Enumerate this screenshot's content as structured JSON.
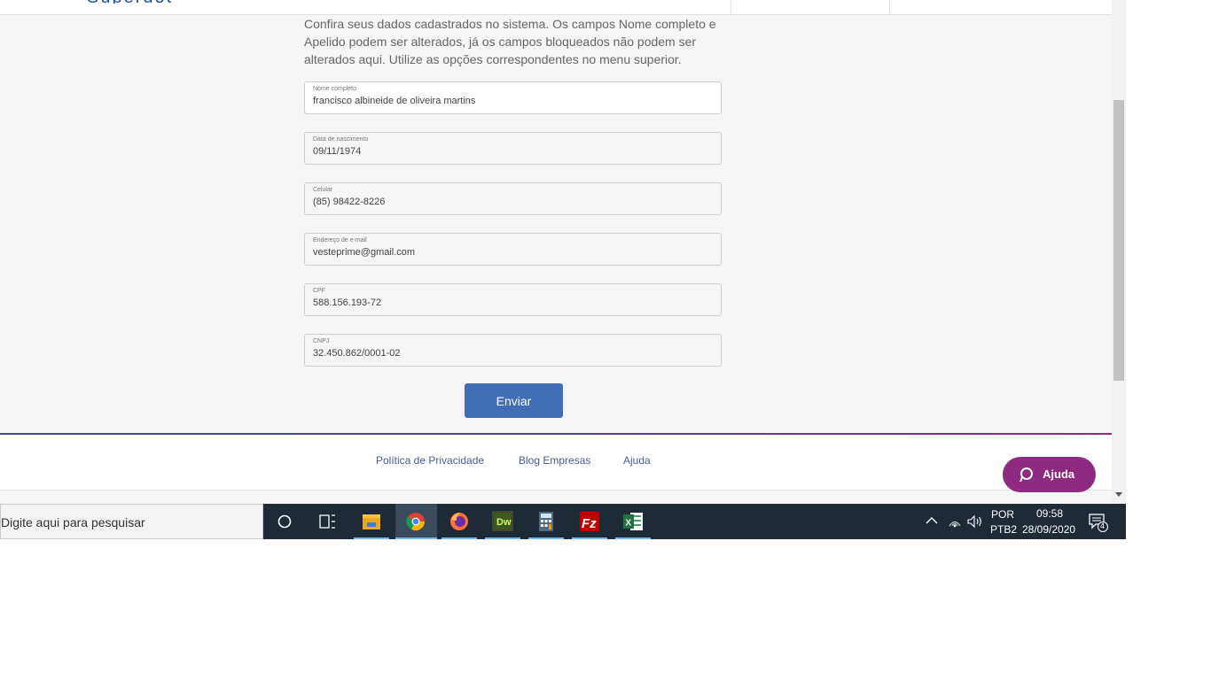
{
  "page": {
    "intro": "Confira seus dados cadastrados no sistema. Os campos Nome completo e Apelido podem ser alterados, já os campos bloqueados não podem ser alterados aqui. Utilize as opções correspondentes no menu superior.",
    "fields": [
      {
        "label": "Nome completo",
        "value": "francisco albineide de oliveira martins"
      },
      {
        "label": "Data de nascimento",
        "value": "09/11/1974"
      },
      {
        "label": "Celular",
        "value": "(85) 98422-8226"
      },
      {
        "label": "Endereço de e-mail",
        "value": "vesteprime@gmail.com"
      },
      {
        "label": "CPF",
        "value": "588.156.193-72"
      },
      {
        "label": "CNPJ",
        "value": "32.450.862/0001-02"
      }
    ],
    "submit_label": "Enviar"
  },
  "footer": {
    "links": [
      "Política de Privacidade",
      "Blog Empresas",
      "Ajuda"
    ],
    "help_button": "Ajuda"
  },
  "taskbar": {
    "search_placeholder": "Digite aqui para pesquisar",
    "apps": [
      "cortana-icon",
      "task-view-icon",
      "file-explorer-icon",
      "chrome-icon",
      "firefox-icon",
      "dreamweaver-icon",
      "calculator-icon",
      "filezilla-icon",
      "excel-icon"
    ],
    "lang_top": "POR",
    "lang_bottom": "PTB2",
    "time": "09:58",
    "date": "28/09/2020",
    "notifications": "4"
  },
  "colors": {
    "primary": "#3f6eb5",
    "help": "#8e2a7f",
    "taskbar": "#1e2a36"
  }
}
